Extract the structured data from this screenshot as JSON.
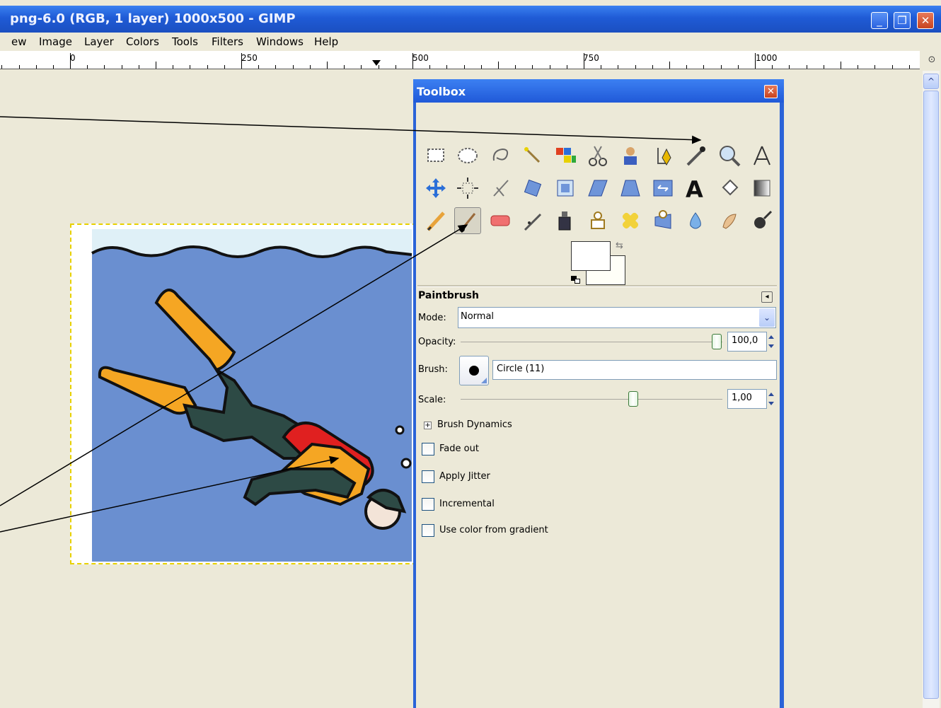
{
  "window": {
    "title": "png-6.0 (RGB, 1 layer) 1000x500 - GIMP",
    "buttons": {
      "minimize": "_",
      "restore": "❐",
      "close": "✕"
    }
  },
  "menu": [
    "ew",
    "Image",
    "Layer",
    "Colors",
    "Tools",
    "Filters",
    "Windows",
    "Help"
  ],
  "ruler": {
    "labels": [
      "0",
      "250",
      "500",
      "750",
      "1000"
    ]
  },
  "toolbox": {
    "title": "Toolbox",
    "tools_row1": [
      "rect-select",
      "ellipse-select",
      "free-select",
      "fuzzy-select",
      "select-by-color",
      "scissors",
      "foreground-select",
      "paths",
      "color-picker",
      "zoom",
      "measure"
    ],
    "tools_row2": [
      "move",
      "align",
      "crop",
      "rotate",
      "scale",
      "shear",
      "perspective",
      "flip",
      "text",
      "bucket-fill",
      "blend"
    ],
    "tools_row3": [
      "pencil",
      "paintbrush",
      "eraser",
      "airbrush",
      "ink",
      "clone",
      "heal",
      "perspective-clone",
      "blur",
      "smudge",
      "dodge-burn"
    ],
    "active_tool": "paintbrush"
  },
  "options": {
    "title": "Paintbrush",
    "mode_label": "Mode:",
    "mode_value": "Normal",
    "opacity_label": "Opacity:",
    "opacity_value": "100,0",
    "opacity_fraction": 1.0,
    "brush_label": "Brush:",
    "brush_value": "Circle (11)",
    "scale_label": "Scale:",
    "scale_value": "1,00",
    "scale_fraction": 0.65,
    "dynamics_label": "Brush Dynamics",
    "fade_label": "Fade out",
    "jitter_label": "Apply Jitter",
    "incremental_label": "Incremental",
    "gradient_label": "Use color from gradient"
  },
  "colors": {
    "foreground": "#ffffff",
    "background": "#fffff8",
    "accent": "#2a63d8"
  }
}
